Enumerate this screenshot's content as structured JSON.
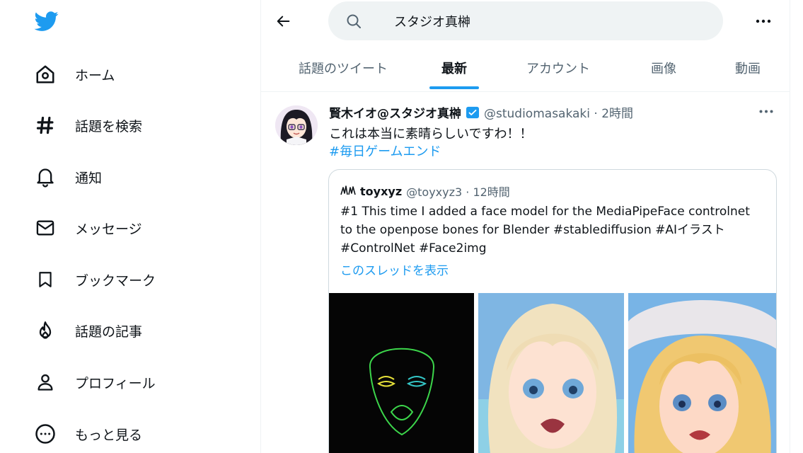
{
  "sidebar": {
    "items": [
      {
        "label": "ホーム",
        "icon": "home-icon"
      },
      {
        "label": "話題を検索",
        "icon": "hashtag-icon"
      },
      {
        "label": "通知",
        "icon": "bell-icon"
      },
      {
        "label": "メッセージ",
        "icon": "mail-icon"
      },
      {
        "label": "ブックマーク",
        "icon": "bookmark-icon"
      },
      {
        "label": "話題の記事",
        "icon": "flame-icon"
      },
      {
        "label": "プロフィール",
        "icon": "person-icon"
      },
      {
        "label": "もっと見る",
        "icon": "more-circle-icon"
      }
    ]
  },
  "search": {
    "value": "スタジオ真榊"
  },
  "tabs": [
    {
      "label": "話題のツイート",
      "active": false
    },
    {
      "label": "最新",
      "active": true
    },
    {
      "label": "アカウント",
      "active": false
    },
    {
      "label": "画像",
      "active": false
    },
    {
      "label": "動画",
      "active": false
    }
  ],
  "tweet": {
    "author_name": "賢木イオ@スタジオ真榊",
    "handle_time": "@studiomasakaki · 2時間",
    "text": "これは本当に素晴らしいですわ！！",
    "hashtag": "#毎日ゲームエンド",
    "quote": {
      "author_name": "toyxyz",
      "handle_time": "@toyxyz3 · 12時間",
      "text": "#1 This time I added a face model for the MediaPipeFace controlnet to the openpose bones for Blender #stablediffusion #AIイラスト #ControlNet #Face2img",
      "thread_link": "このスレッドを表示"
    }
  },
  "colors": {
    "accent": "#1d9bf0",
    "text": "#0f1419",
    "muted": "#536471",
    "search_bg": "#eff3f4"
  }
}
